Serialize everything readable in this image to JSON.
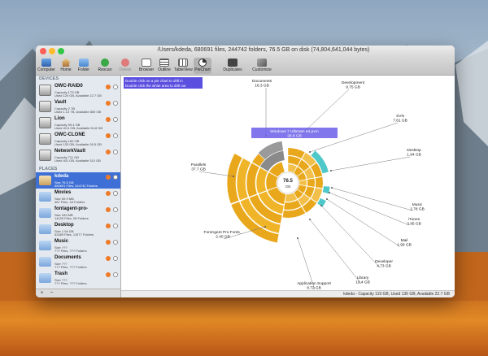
{
  "window": {
    "title": "/Users/kdeda, 680691 files, 244742 folders, 76.5 GB on disk (74,804,641,044 bytes)"
  },
  "toolbar": [
    {
      "label": "Computer",
      "icon": "computer-icon"
    },
    {
      "label": "Home",
      "icon": "home-icon"
    },
    {
      "label": "Folder",
      "icon": "folder-icon"
    },
    {
      "label": "Rescan",
      "icon": "rescan-icon"
    },
    {
      "label": "Delete",
      "icon": "delete-icon",
      "disabled": true
    },
    {
      "label": "Browser",
      "icon": "browser-icon"
    },
    {
      "label": "Outline",
      "icon": "outline-icon"
    },
    {
      "label": "TableView",
      "icon": "tableview-icon"
    },
    {
      "label": "PieChart",
      "icon": "piechart-icon",
      "active": true
    },
    {
      "label": "Duplicates",
      "icon": "duplicates-icon"
    },
    {
      "label": "Customize",
      "icon": "customize-icon"
    }
  ],
  "sidebar": {
    "devices_header": "DEVICES",
    "places_header": "PLACES",
    "devices": [
      {
        "name": "OWC-RAID0",
        "line1": "Capacity 1T3 GB",
        "line2": "Used 120 GB, Available 22.7 GB"
      },
      {
        "name": "Vault",
        "line1": "Capacity 2 TB",
        "line2": "Used 1.13 TB, Available 860 GB"
      },
      {
        "name": "Lion",
        "line1": "Capacity 95.4 GB",
        "line2": "Used 40.6 GB, Available 54.8 GB"
      },
      {
        "name": "OWC-CLONE",
        "line1": "Capacity 160 GB",
        "line2": "Used 133 GB, Available 26.5 GB"
      },
      {
        "name": "NetworkVault",
        "line1": "Capacity 711 GB",
        "line2": "Used 401 GB, Available 310 GB"
      }
    ],
    "places": [
      {
        "name": "kdeda",
        "line1": "Size 76.5 GB",
        "line2": "680691 Files, 244742 Folders",
        "selected": true
      },
      {
        "name": "Movies",
        "line1": "Size 59.9 MB",
        "line2": "487 Files, 18 Folders"
      },
      {
        "name": "fontagent-pro-",
        "line1": "Size 449 MB",
        "line2": "14109 Files, 28 Folders"
      },
      {
        "name": "Desktop",
        "line1": "Size 1.94 GB",
        "line2": "52469 Files, 11577 Folders"
      },
      {
        "name": "Music",
        "line1": "Size ???",
        "line2": "??? Files, ??? Folders"
      },
      {
        "name": "Documents",
        "line1": "Size ???",
        "line2": "??? Files, ??? Folders"
      },
      {
        "name": "Trash",
        "line1": "Size ???",
        "line2": "??? Files, ??? Folders"
      }
    ],
    "add_button": "+",
    "remove_button": "−"
  },
  "hint": {
    "line1": "Double click on a pie chart to drill in",
    "line2": "Double click the white area to drill out"
  },
  "pie": {
    "center_size": "76.5",
    "center_unit": "GB",
    "tooltip_name": "Windows 7 Ultimate 64.pvm",
    "tooltip_size": "28.8 GB",
    "labels": [
      {
        "name": "Documents",
        "size": "18.3 GB"
      },
      {
        "name": "Development",
        "size": "9.75 GB"
      },
      {
        "name": "SVN",
        "size": "7.61 GB"
      },
      {
        "name": "Desktop",
        "size": "1.94 GB"
      },
      {
        "name": "Music",
        "size": "2.78 GB"
      },
      {
        "name": "iTunes",
        "size": "3.95 GB"
      },
      {
        "name": "Mail",
        "size": "1.99 GB"
      },
      {
        "name": "Developer",
        "size": "4.73 GB"
      },
      {
        "name": "Library",
        "size": "19.4 GB"
      },
      {
        "name": "Application Support",
        "size": "8.72 GB"
      },
      {
        "name": "FontAgent Pro Fonts_",
        "size": "2.40 GB"
      },
      {
        "name": "Parallels",
        "size": "37.7 GB"
      }
    ]
  },
  "status": {
    "text": "kdeda - Capacity 119 GB, Used 136 GB, Available 22.7 GB"
  }
}
